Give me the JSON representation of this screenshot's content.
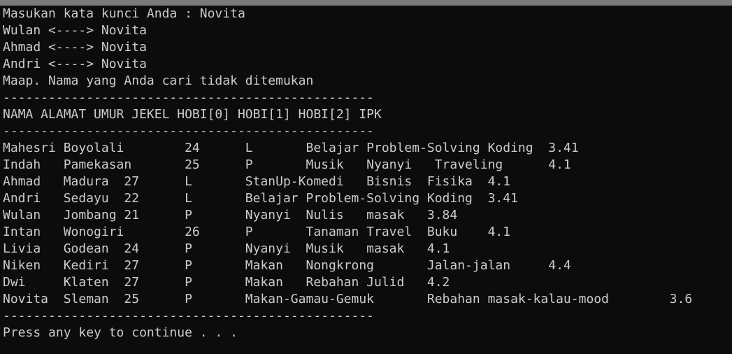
{
  "console": {
    "lines": [
      "Masukan kata kunci Anda : Novita",
      "Wulan <----> Novita",
      "Ahmad <----> Novita",
      "Andri <----> Novita",
      "Maap. Nama yang Anda cari tidak ditemukan",
      "-------------------------------------------------",
      "NAMA ALAMAT UMUR JEKEL HOBI[0] HOBI[1] HOBI[2] IPK",
      "-------------------------------------------------",
      "Mahesri Boyolali        24      L       Belajar Problem-Solving Koding  3.41",
      "Indah   Pamekasan       25      P       Musik   Nyanyi   Traveling      4.1",
      "Ahmad   Madura  27      L       StanUp-Komedi   Bisnis  Fisika  4.1",
      "Andri   Sedayu  22      L       Belajar Problem-Solving Koding  3.41",
      "Wulan   Jombang 21      P       Nyanyi  Nulis   masak   3.84",
      "Intan   Wonogiri        26      P       Tanaman Travel  Buku    4.1",
      "Livia   Godean  24      P       Nyanyi  Musik   masak   4.1",
      "Niken   Kediri  27      P       Makan   Nongkrong       Jalan-jalan     4.4",
      "Dwi     Klaten  27      P       Makan   Rebahan Julid   4.2",
      "Novita  Sleman  25      P       Makan-Gamau-Gemuk       Rebahan masak-kalau-mood        3.6",
      "-------------------------------------------------",
      "Press any key to continue . . ."
    ]
  }
}
